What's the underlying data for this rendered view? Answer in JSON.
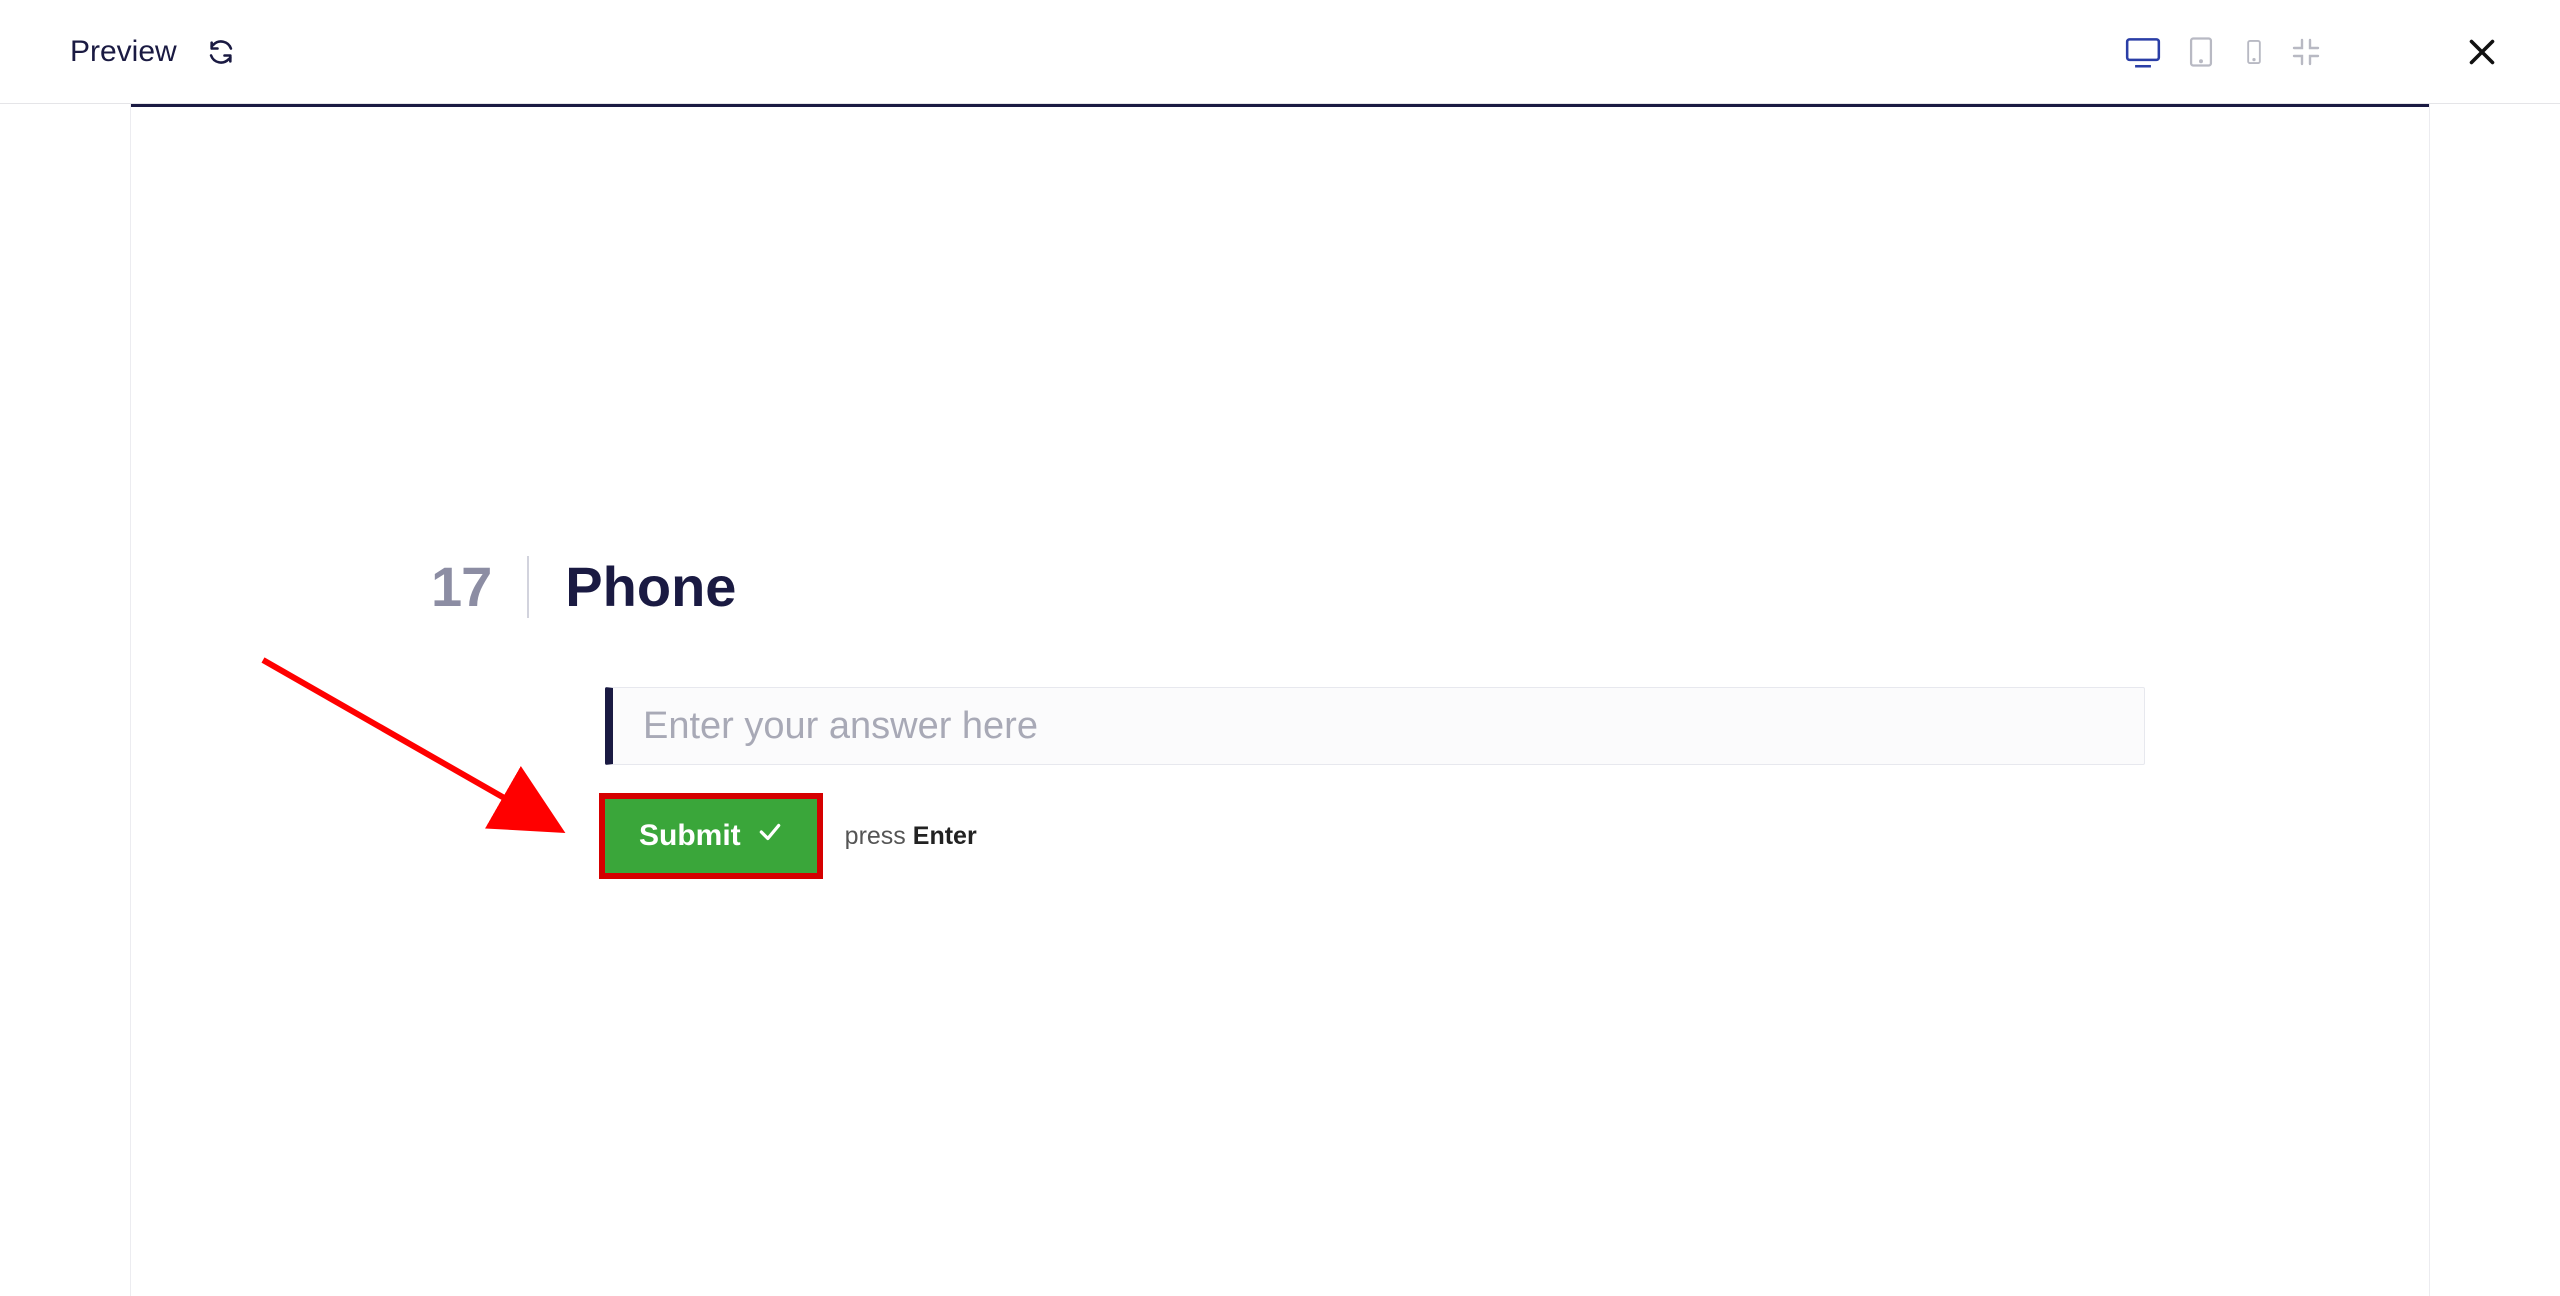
{
  "header": {
    "title": "Preview"
  },
  "question": {
    "number": "17",
    "title": "Phone",
    "input_placeholder": "Enter your answer here",
    "input_value": ""
  },
  "actions": {
    "submit_label": "Submit",
    "hint_prefix": "press ",
    "hint_key": "Enter"
  }
}
